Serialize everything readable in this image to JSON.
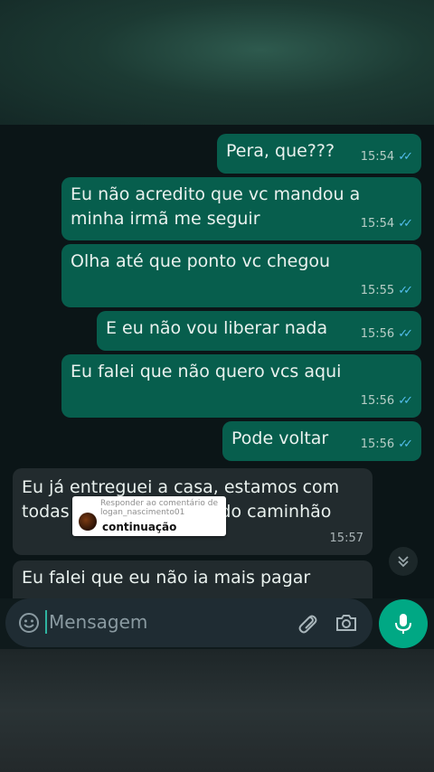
{
  "messages": [
    {
      "text": "Pera, que???",
      "time": "15:54",
      "status": "read"
    },
    {
      "text": "Eu não acredito que vc mandou a\nminha irmã me seguir",
      "time": "15:54",
      "status": "read"
    },
    {
      "text": "Olha até que ponto vc chegou",
      "time": "15:55",
      "status": "read"
    },
    {
      "text": "E eu não vou liberar nada",
      "time": "15:56",
      "status": "read"
    },
    {
      "text": "Eu falei que não quero vcs aqui",
      "time": "15:56",
      "status": "read"
    },
    {
      "text": "Pode voltar",
      "time": "15:56",
      "status": "read"
    },
    {
      "text": "Eu já entreguei a casa, estamos com\ntodas as coisas dentro do caminhão",
      "time": "15:57"
    },
    {
      "text": "Eu falei que eu não ia mais pagar"
    }
  ],
  "reply_sticker": {
    "header": "Responder ao comentário de logan_nascimento01",
    "body": "continuação"
  },
  "composer": {
    "placeholder": "Mensagem"
  },
  "icons": {
    "emoji": "emoji-icon",
    "attach": "paperclip-icon",
    "camera": "camera-icon",
    "mic": "microphone-icon",
    "scroll": "chevron-double-down-icon",
    "read": "double-check-icon"
  },
  "colors": {
    "outgoing_bubble": "#075e4d",
    "incoming_bubble": "#222b2e",
    "chat_background": "#0b1517",
    "accent": "#00a884",
    "read_ticks": "#53bdeb"
  }
}
